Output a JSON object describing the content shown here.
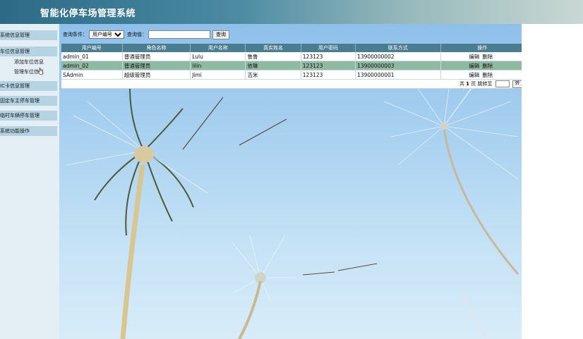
{
  "header": {
    "title": "智能化停车场管理系统"
  },
  "sidebar": {
    "items": [
      {
        "label": "系统信息管理"
      },
      {
        "label": "车位信息管理"
      },
      {
        "label": "IC卡信息管理"
      },
      {
        "label": "固定车主停车管理"
      },
      {
        "label": "临时车辆停车管理"
      },
      {
        "label": "系统功能操作"
      }
    ],
    "sub_items": [
      {
        "label": "添加车位信息"
      },
      {
        "label": "管理车位信息"
      }
    ]
  },
  "query": {
    "condition_label": "查询条件：",
    "condition_selected": "用户编号",
    "value_label": "查询值：",
    "value": "",
    "search_label": "查询"
  },
  "table": {
    "headers": [
      "用户编号",
      "角色名称",
      "用户名称",
      "真实姓名",
      "用户密码",
      "联系方式",
      "操作"
    ],
    "rows": [
      {
        "cells": [
          "admin_01",
          "普通管理员",
          "Lulu",
          "鲁鲁",
          "123123",
          "13900000002"
        ],
        "edit": "编辑",
        "delete": "删除"
      },
      {
        "cells": [
          "admin_02",
          "普通管理员",
          "lilin",
          "依琳",
          "123123",
          "13900000003"
        ],
        "edit": "编辑",
        "delete": "删除"
      },
      {
        "cells": [
          "SAdmin",
          "超级管理员",
          "Jimi",
          "吉米",
          "123123",
          "13900000001"
        ],
        "edit": "编辑",
        "delete": "删除"
      }
    ]
  },
  "pager": {
    "total_prefix": "共",
    "total_pages": "1",
    "total_suffix": "页 跳转至",
    "go_label": "转"
  },
  "colors": {
    "header_bg": "#2c6a86",
    "table_header_bg": "#4b7d92",
    "selected_row_bg": "#8fb9a2",
    "sidebar_item_bg": "#b5d3e3"
  }
}
